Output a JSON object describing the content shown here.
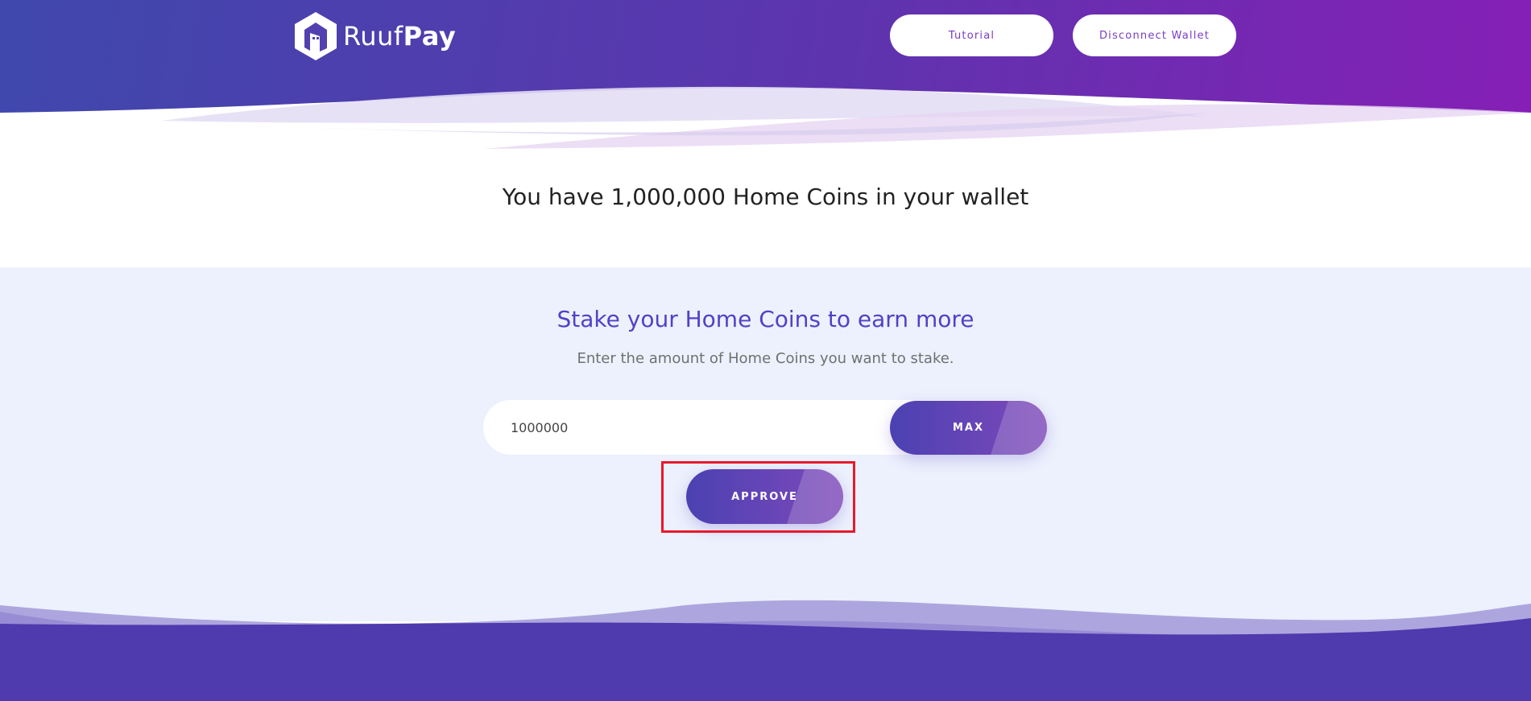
{
  "header": {
    "logo": {
      "text_light": "Ruuf",
      "text_bold": "Pay",
      "icon": "house-hexagon-icon"
    },
    "nav": {
      "tutorial_label": "Tutorial",
      "disconnect_label": "Disconnect Wallet"
    }
  },
  "wallet": {
    "balance_text": "You have 1,000,000 Home Coins in your wallet"
  },
  "stake": {
    "title": "Stake your Home Coins to earn more",
    "subtitle": "Enter the amount of Home Coins you want to stake.",
    "amount_value": "1000000",
    "max_label": "MAX",
    "approve_label": "APPROVE"
  },
  "colors": {
    "header_gradient_start": "#3f48ad",
    "header_gradient_end": "#861fb6",
    "accent_purple": "#5440c6",
    "section_bg": "#ecf1fd",
    "footer_purple": "#4f3aae",
    "highlight_red": "#e8192c"
  }
}
